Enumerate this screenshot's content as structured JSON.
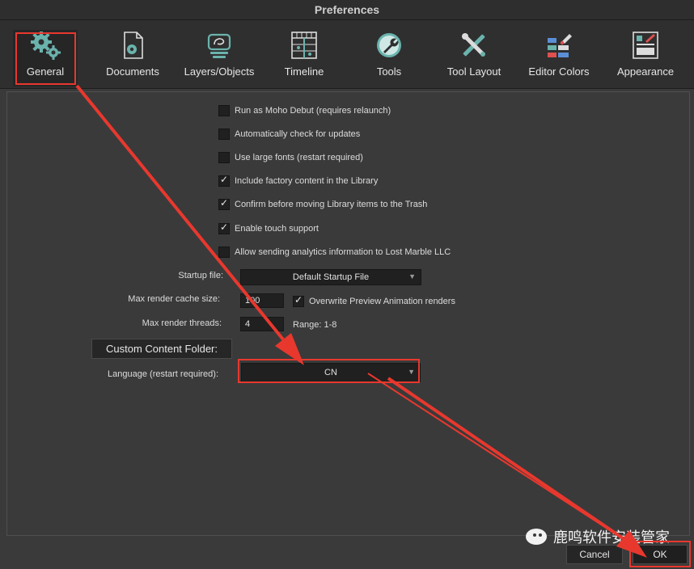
{
  "window": {
    "title": "Preferences"
  },
  "tabs": [
    {
      "label": "General",
      "icon": "gear-icon",
      "active": true
    },
    {
      "label": "Documents",
      "icon": "document-icon"
    },
    {
      "label": "Layers/Objects",
      "icon": "layers-icon"
    },
    {
      "label": "Timeline",
      "icon": "timeline-icon"
    },
    {
      "label": "Tools",
      "icon": "wrench-icon"
    },
    {
      "label": "Tool Layout",
      "icon": "tools-cross-icon"
    },
    {
      "label": "Editor Colors",
      "icon": "palette-icon"
    },
    {
      "label": "Appearance",
      "icon": "appearance-icon"
    }
  ],
  "checkboxes": [
    {
      "label": "Run as Moho Debut (requires relaunch)",
      "checked": false
    },
    {
      "label": "Automatically check for updates",
      "checked": false
    },
    {
      "label": "Use large fonts (restart required)",
      "checked": false
    },
    {
      "label": "Include factory content in the Library",
      "checked": true
    },
    {
      "label": "Confirm before moving Library items to the Trash",
      "checked": true
    },
    {
      "label": "Enable touch support",
      "checked": true
    },
    {
      "label": "Allow sending analytics information to Lost Marble LLC",
      "checked": false
    }
  ],
  "settings": {
    "startup_file_label": "Startup file:",
    "startup_file_value": "Default Startup File",
    "cache_label": "Max render cache size:",
    "cache_value": "100",
    "overwrite_label": "Overwrite Preview Animation renders",
    "overwrite_checked": true,
    "threads_label": "Max render threads:",
    "threads_value": "4",
    "threads_range": "Range: 1-8",
    "custom_folder_button": "Custom Content Folder:",
    "language_label": "Language (restart required):",
    "language_value": "CN",
    "check_mark": "✓",
    "arrow_glyph": "▼"
  },
  "footer": {
    "cancel": "Cancel",
    "ok": "OK"
  },
  "watermark": {
    "text": "鹿鸣软件安装管家"
  },
  "colors": {
    "annotation_red": "#e8382e",
    "icon_teal": "#6bb3ad"
  }
}
